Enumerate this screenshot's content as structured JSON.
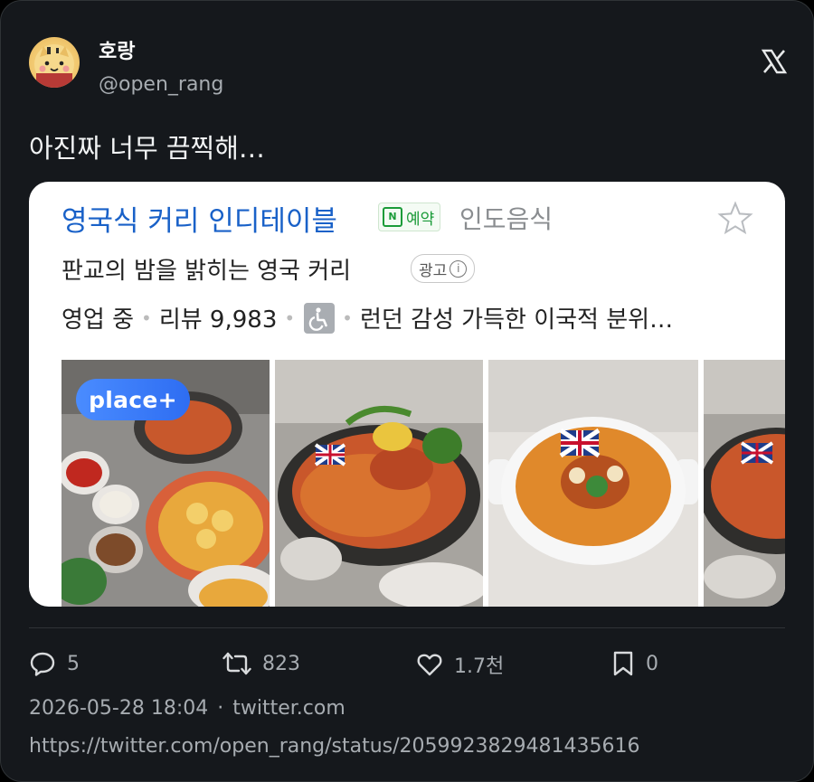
{
  "author": {
    "display_name": "호랑",
    "handle": "@open_rang"
  },
  "tweet": {
    "text": "아진짜 너무 끔찍해…"
  },
  "ad": {
    "title": "영국식 커리 인디테이블",
    "badge_reserve": "예약",
    "badge_n": "N",
    "category": "인도음식",
    "subtitle": "판교의 밤을 밝히는 영국 커리",
    "ad_label": "광고",
    "info_glyph": "i",
    "status": "영업 중",
    "reviews": "리뷰 9,983",
    "description": "런던 감성 가득한 이국적 분위…",
    "place_badge": "place+"
  },
  "actions": {
    "replies": "5",
    "retweets": "823",
    "likes": "1.7천",
    "bookmarks": "0"
  },
  "meta": {
    "timestamp": "2026-05-28 18:04",
    "separator": "·",
    "source": "twitter.com",
    "url": "https://twitter.com/open_rang/status/2059923829481435616"
  },
  "icons": {
    "reply": "reply-icon",
    "retweet": "retweet-icon",
    "like": "heart-icon",
    "bookmark": "bookmark-icon",
    "logo": "x-logo-icon",
    "star": "star-icon",
    "accessibility": "wheelchair-icon"
  },
  "colors": {
    "background": "#15181c",
    "ad_title": "#1961c8",
    "reserve_green": "#1b9b39",
    "place_blue": "#2e6df2",
    "muted_text": "#a7acb1"
  }
}
